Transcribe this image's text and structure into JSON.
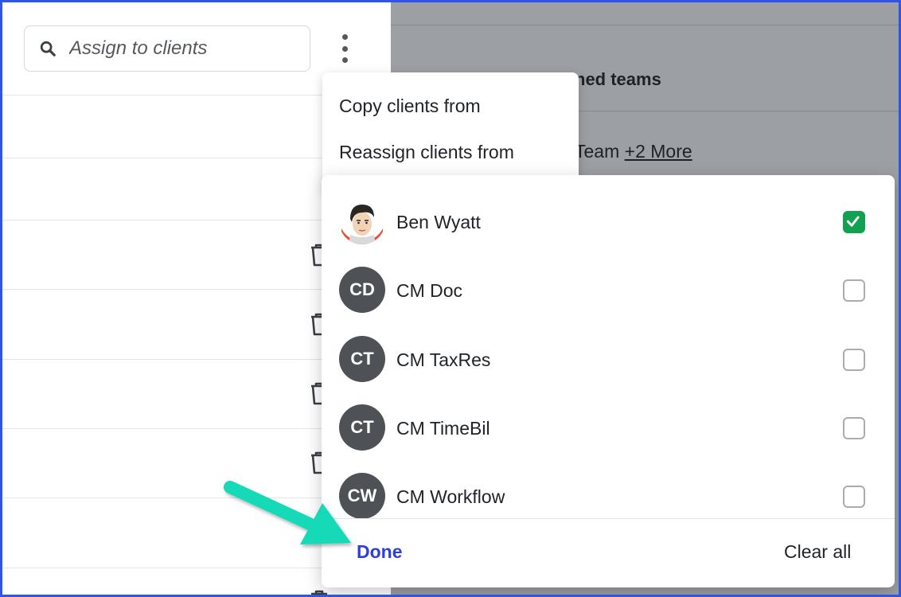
{
  "search": {
    "placeholder": "Assign to clients"
  },
  "right_panel": {
    "heading_partial": "ned teams",
    "team_partial": "Team",
    "more_link": "+2 More"
  },
  "context_menu": {
    "items": [
      {
        "label": "Copy clients from"
      },
      {
        "label": "Reassign clients from"
      }
    ]
  },
  "dropdown": {
    "options": [
      {
        "name": "Ben Wyatt",
        "initials": "",
        "avatar_type": "photo",
        "checked": true
      },
      {
        "name": "CM Doc",
        "initials": "CD",
        "avatar_type": "initials",
        "checked": false
      },
      {
        "name": "CM TaxRes",
        "initials": "CT",
        "avatar_type": "initials",
        "checked": false
      },
      {
        "name": "CM TimeBil",
        "initials": "CT",
        "avatar_type": "initials",
        "checked": false
      },
      {
        "name": "CM Workflow",
        "initials": "CW",
        "avatar_type": "initials",
        "checked": false
      }
    ],
    "done_label": "Done",
    "clear_label": "Clear all"
  },
  "colors": {
    "frame_border": "#2e55e6",
    "checkbox_checked": "#12a150",
    "done_text": "#2f3fd6",
    "avatar_bg": "#4e5156",
    "annotation_arrow": "#19d9b8",
    "overlay": "#9c9fa3"
  },
  "icons": {
    "search": "search-icon",
    "menu": "kebab-menu-icon",
    "delete": "trash-icon",
    "check": "checkmark-icon",
    "annotation": "arrow-icon"
  }
}
